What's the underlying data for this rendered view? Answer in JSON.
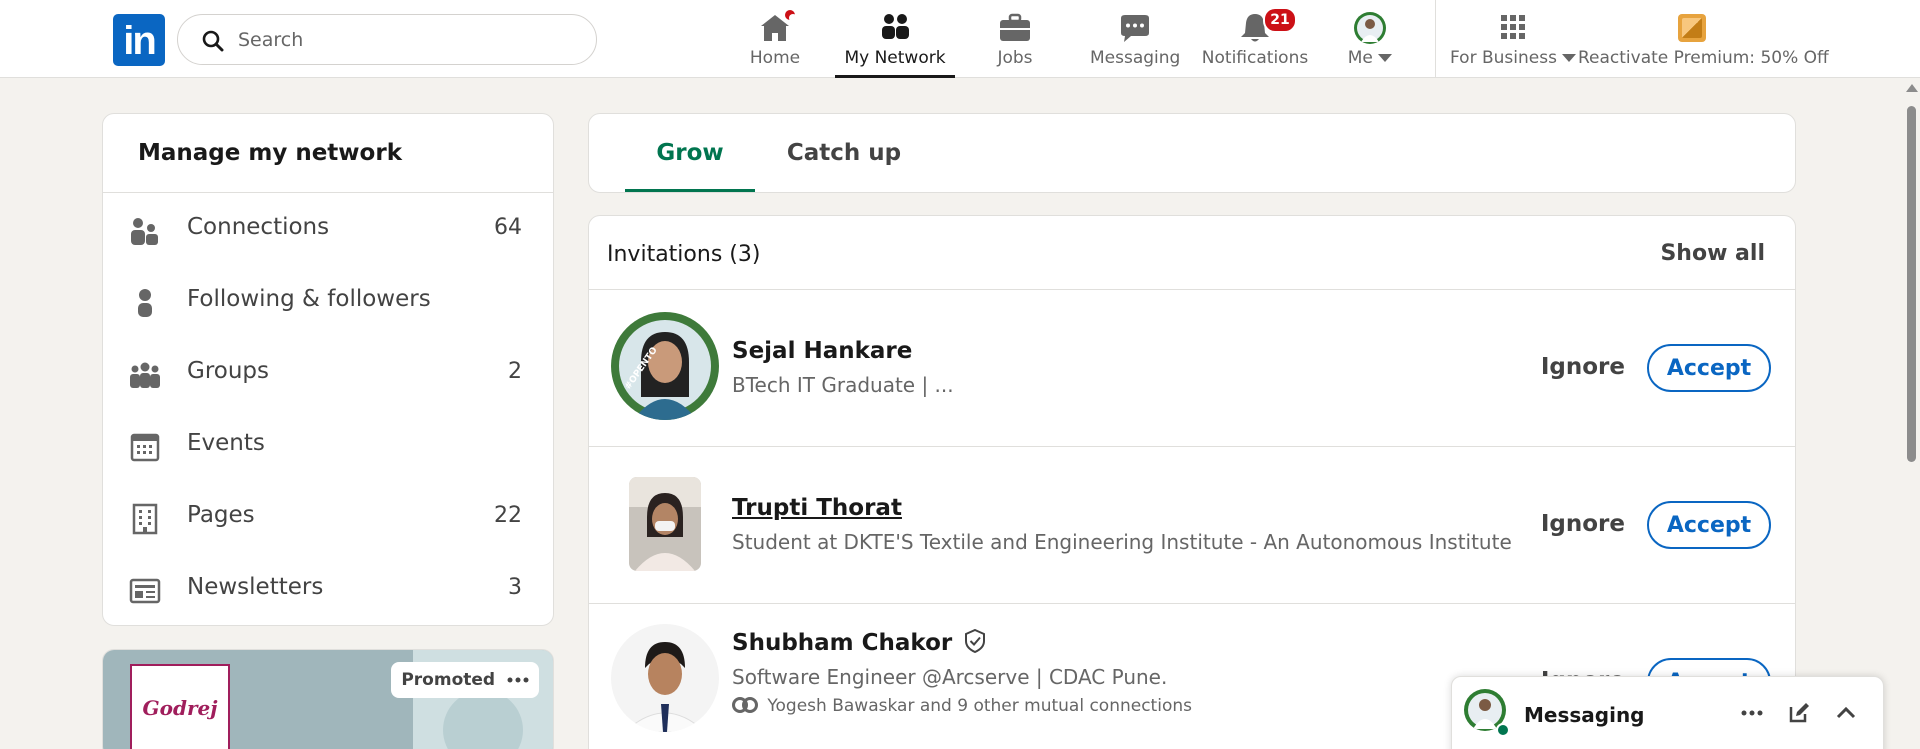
{
  "nav": {
    "search_placeholder": "Search",
    "items": [
      {
        "label": "Home"
      },
      {
        "label": "My Network"
      },
      {
        "label": "Jobs"
      },
      {
        "label": "Messaging"
      },
      {
        "label": "Notifications",
        "badge": "21"
      },
      {
        "label": "Me"
      },
      {
        "label": "For Business"
      },
      {
        "label": "Reactivate Premium: 50% Off"
      }
    ]
  },
  "manage": {
    "title": "Manage my network",
    "items": [
      {
        "label": "Connections",
        "count": "64",
        "icon": "connections-icon"
      },
      {
        "label": "Following & followers",
        "count": "",
        "icon": "person-icon"
      },
      {
        "label": "Groups",
        "count": "2",
        "icon": "groups-icon"
      },
      {
        "label": "Events",
        "count": "",
        "icon": "calendar-icon"
      },
      {
        "label": "Pages",
        "count": "22",
        "icon": "building-icon"
      },
      {
        "label": "Newsletters",
        "count": "3",
        "icon": "newsletter-icon"
      }
    ]
  },
  "promo": {
    "brand": "Godrej",
    "tag": "Promoted"
  },
  "tabs": [
    {
      "label": "Grow"
    },
    {
      "label": "Catch up"
    }
  ],
  "invitations": {
    "header": "Invitations (3)",
    "show_all": "Show all",
    "ignore_label": "Ignore",
    "accept_label": "Accept",
    "rows": [
      {
        "name": "Sejal Hankare",
        "subtitle": "BTech IT Graduate | ...",
        "mutual": ""
      },
      {
        "name": "Trupti Thorat",
        "subtitle": "Student at DKTE'S Textile and Engineering Institute - An Autonomous Institute",
        "mutual": ""
      },
      {
        "name": "Shubham Chakor",
        "subtitle": "Software Engineer @Arcserve | CDAC Pune.",
        "mutual": "Yogesh Bawaskar and 9 other mutual connections"
      }
    ]
  },
  "messaging": {
    "title": "Messaging"
  },
  "colors": {
    "brand": "#0a66c2",
    "accent_green": "#01754f",
    "badge_red": "#cc1016"
  }
}
